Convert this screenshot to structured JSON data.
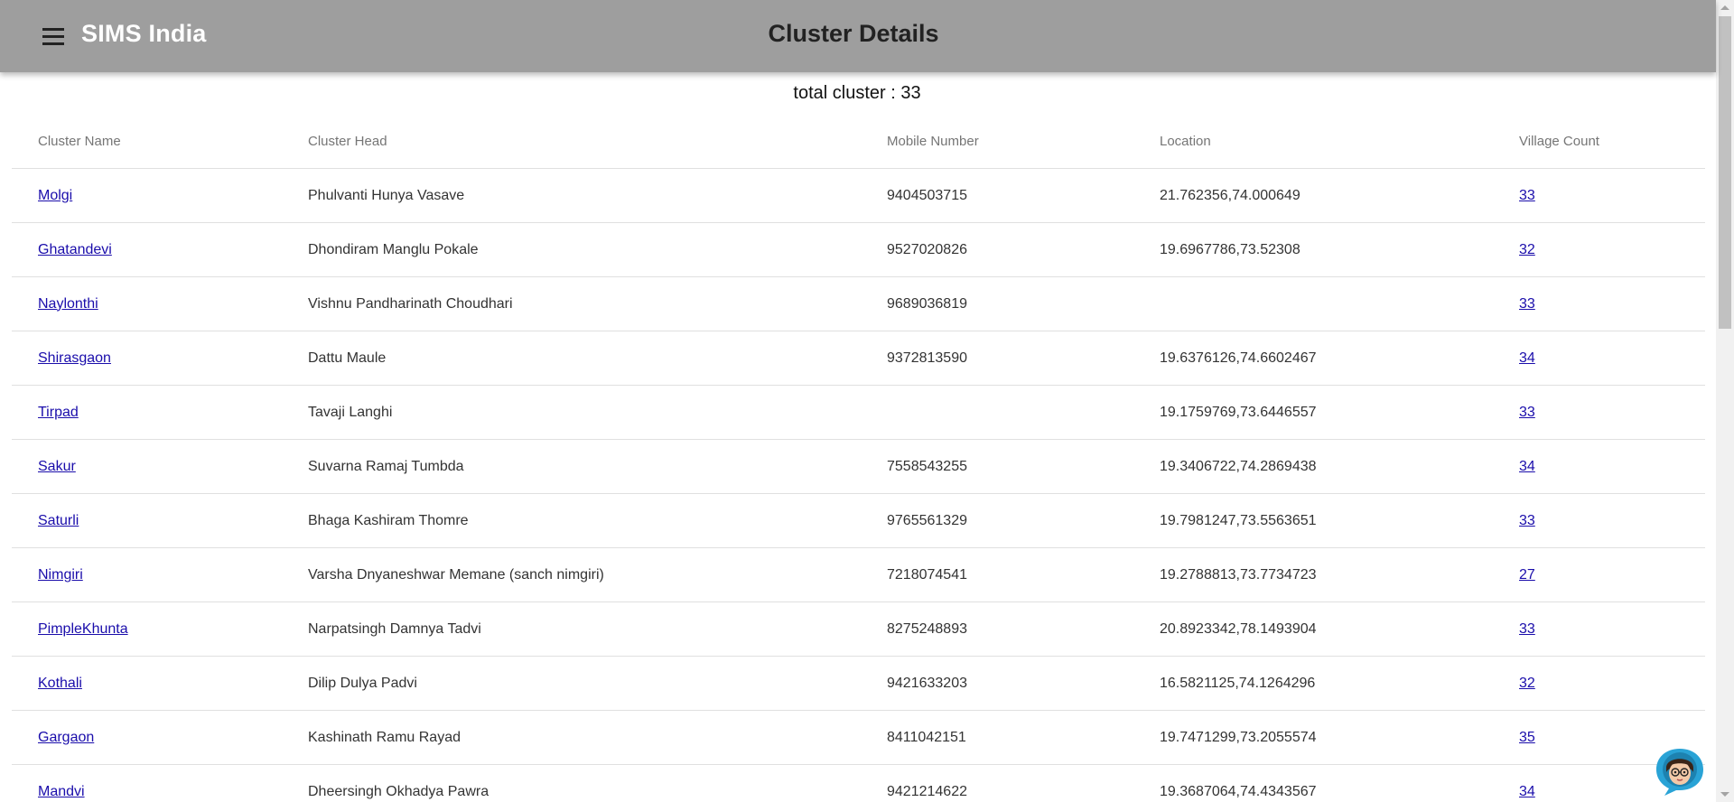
{
  "app": {
    "name": "SIMS India",
    "page_title": "Cluster Details"
  },
  "summary": {
    "total_text": "total cluster : 33"
  },
  "table": {
    "headers": [
      "Cluster Name",
      "Cluster Head",
      "Mobile Number",
      "Location",
      "Village Count"
    ],
    "rows": [
      [
        "Molgi",
        "Phulvanti Hunya Vasave",
        "9404503715",
        "21.762356,74.000649",
        "33"
      ],
      [
        "Ghatandevi",
        "Dhondiram Manglu Pokale",
        "9527020826",
        "19.6967786,73.52308",
        "32"
      ],
      [
        "Naylonthi",
        "Vishnu Pandharinath Choudhari",
        "9689036819",
        "",
        "33"
      ],
      [
        "Shirasgaon",
        "Dattu Maule",
        "9372813590",
        "19.6376126,74.6602467",
        "34"
      ],
      [
        "Tirpad",
        "Tavaji Langhi",
        "",
        "19.1759769,73.6446557",
        "33"
      ],
      [
        "Sakur",
        "Suvarna Ramaj Tumbda",
        "7558543255",
        "19.3406722,74.2869438",
        "34"
      ],
      [
        "Saturli",
        "Bhaga Kashiram Thomre",
        "9765561329",
        "19.7981247,73.5563651",
        "33"
      ],
      [
        "Nimgiri",
        "Varsha Dnyaneshwar Memane (sanch nimgiri)",
        "7218074541",
        "19.2788813,73.7734723",
        "27"
      ],
      [
        "PimpleKhunta",
        "Narpatsingh Damnya Tadvi",
        "8275248893",
        "20.8923342,78.1493904",
        "33"
      ],
      [
        "Kothali",
        "Dilip Dulya Padvi",
        "9421633203",
        "16.5821125,74.1264296",
        "32"
      ],
      [
        "Gargaon",
        "Kashinath Ramu Rayad",
        "8411042151",
        "19.7471299,73.2055574",
        "35"
      ],
      [
        "Mandvi",
        "Dheersingh Okhadya Pawra",
        "9421214622",
        "19.3687064,74.4343567",
        "34"
      ]
    ]
  },
  "icons": {
    "menu": "menu-icon",
    "chat": "chatbot-avatar-icon"
  },
  "colors": {
    "app_bar": "#9e9e9e",
    "link": "#1a0dab",
    "header_text": "#757575"
  }
}
